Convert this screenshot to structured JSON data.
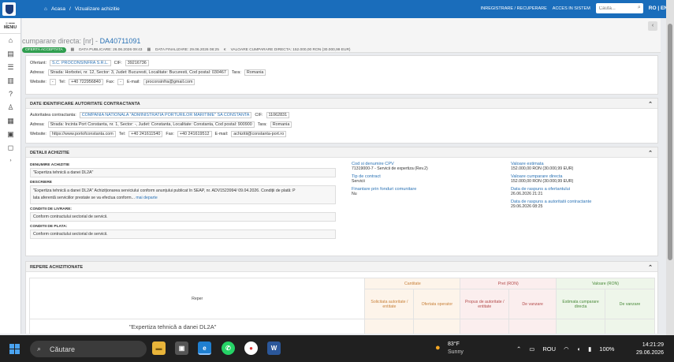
{
  "topbar": {
    "home": "Acasa",
    "separator": "/",
    "section": "Vizualizare achizitie",
    "register": "INREGISTRARE / RECUPERARE",
    "login": "ACCES IN SISTEM",
    "search_placeholder": "Cauta...",
    "lang": "RO | EN"
  },
  "sidebar": {
    "menu_label": "MENIU",
    "menu_top": "≡ •••••"
  },
  "header": {
    "title_prefix": "cumparare directa: [nr] -",
    "title_id": "DA40711091",
    "status": "OFERTA ACCEPTATA",
    "published": "DATA PUBLICARE: 26.06.2026 09:43",
    "finalized": "DATA FINALIZARE: 29.06.2026 08:25",
    "value": "VALOARE CUMPARARE DIRECTA: 152.000,00 RON (30.000,99 EUR)"
  },
  "offer": {
    "label_offerer": "Ofertant:",
    "offerer": "S.C. PROCONSINFRA S.R.L.",
    "label_cif": "CIF:",
    "cif": "39216736",
    "label_address": "Adresa:",
    "address": "Strada: Horbotei, nr. 12, Sector: 3, Judet: Bucuresti, Localitate: Bucuresti, Cod postal: 030467",
    "label_country": "Tara:",
    "country": "Romania",
    "label_website": "Website:",
    "website": "-",
    "label_tel": "Tel:",
    "tel": "+40 722956840",
    "label_fax": "Fax:",
    "fax": "-",
    "label_email": "E-mail:",
    "email": "proconsinfra@gmail.com"
  },
  "authority": {
    "heading": "DATE IDENTIFICARE AUTORITATE CONTRACTANTA",
    "label_name": "Autoritatea contractanta:",
    "name": "COMPANIA NATIONALA \"ADMINISTRATIA PORTURILOR MARITIME\" SA CONSTANTA",
    "label_cif": "CIF:",
    "cif": "11062831",
    "label_address": "Adresa:",
    "address": "Strada: Incinta Port Constanta, nr. 1, Sector: -, Judet: Constanta, Localitate: Constanta, Cod postal: 900900",
    "label_country": "Tara:",
    "country": "Romania",
    "label_website": "Website:",
    "website": "https://www.portofconstanta.com",
    "label_tel": "Tel:",
    "tel": "+40 241611540",
    "label_fax": "Fax:",
    "fax": "+40 241619512",
    "label_email": "E-mail:",
    "email": "achizitii@constanta-port.ro"
  },
  "details": {
    "heading": "DETALII ACHIZITIE",
    "label_name": "DENUMIRE ACHIZITIE",
    "name": "\"Expertiza tehnică a danei DL2A\"",
    "label_desc": "DESCRIERE",
    "desc_1": "\"Expertiza tehnică a danei DL2A\" Achiziționarea serviciului conform anunțului publicat în SEAP, nr. ADV1523994/ 09.04.2026. Condiții de plată: P",
    "desc_2": "lata aferentă serviciilor prestate se va efectua conform...",
    "more": "mai departe",
    "label_delivery": "CONDITII DE LIVRARE:",
    "delivery": "Conform contractului sectorial de servicii.",
    "label_payment": "CONDITII DE PLATA:",
    "payment": "Conform contractului sectorial de servicii.",
    "label_cpv": "Cod si denumire CPV",
    "cpv": "71319000-7 - Servicii de expertiza (Rev.2)",
    "label_contract": "Tip de contract",
    "contract": "Servicii",
    "label_funds": "Finantare prin fonduri comunitare",
    "funds": "Nu",
    "label_estimated": "Valoare estimata",
    "estimated": "152.000,00 RON (30.000,99 EUR)",
    "label_direct": "Valoare cumparare directa",
    "direct": "152.000,00 RON (30.000,99 EUR)",
    "label_deadline_offer": "Data de raspuns a ofertantului",
    "deadline_offer": "26.06.2026 21:21",
    "label_deadline_auth": "Data de raspuns a autoritatii contractante",
    "deadline_auth": "29.06.2026 08:25"
  },
  "repere": {
    "heading": "REPERE ACHIZITIONATE",
    "col_reper": "Reper",
    "group_qty": "Cantitate",
    "group_price": "Pret (RON)",
    "group_value": "Valoare (RON)",
    "qty_req": "Solicitata autoritate / entitate",
    "qty_offer": "Ofertata operator",
    "price_prop": "Propus de autoritate / entitate",
    "price_sell": "De vanzare",
    "val_est": "Estimata cumparare directa",
    "val_sell": "De vanzare",
    "item": "\"Expertiza tehnică a danei DL2A\""
  },
  "taskbar": {
    "search": "Căutare",
    "temp": "83°F",
    "weather": "Sunny",
    "lang": "ROU",
    "battery": "100%",
    "time": "14:21:29",
    "date": "29.06.2026"
  },
  "colors": {
    "topbar": "#1a6dbb",
    "status_green": "#2f9e4f",
    "link": "#2a72b5",
    "qty_header": "#c8813a",
    "price_header": "#b34b4b",
    "value_header": "#4a8a3a"
  }
}
